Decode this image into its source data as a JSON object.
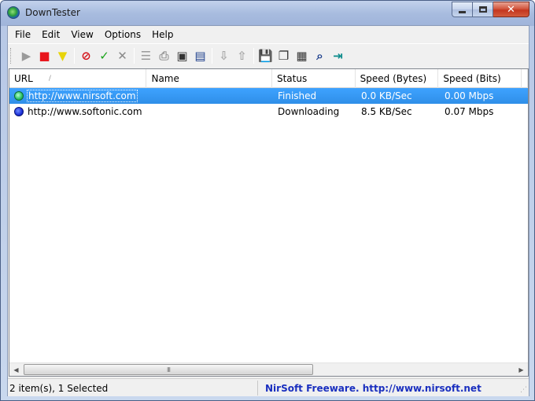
{
  "window": {
    "title": "DownTester"
  },
  "menu": [
    "File",
    "Edit",
    "View",
    "Options",
    "Help"
  ],
  "toolbar": {
    "buttons": [
      {
        "name": "start-icon",
        "glyph": "▶",
        "color": "#9a9a9a"
      },
      {
        "name": "stop-icon",
        "glyph": "■",
        "color": "#e8141b"
      },
      {
        "name": "funnel-icon",
        "glyph": "▼",
        "color": "#e8d40a"
      },
      {
        "name": "block-icon",
        "glyph": "⊘",
        "color": "#d4141b"
      },
      {
        "name": "checkmark-icon",
        "glyph": "✓",
        "color": "#1aa31a"
      },
      {
        "name": "delete-x-icon",
        "glyph": "✕",
        "color": "#8a8a8a"
      },
      {
        "name": "list-icon",
        "glyph": "☰",
        "color": "#9a9a9a"
      },
      {
        "name": "print-icon",
        "glyph": "⎙",
        "color": "#9a9a9a"
      },
      {
        "name": "new-item-icon",
        "glyph": "▣",
        "color": "#333333"
      },
      {
        "name": "window-icon",
        "glyph": "▤",
        "color": "#1c3e8c"
      },
      {
        "name": "move-down-icon",
        "glyph": "⇩",
        "color": "#a8a8a8"
      },
      {
        "name": "move-up-icon",
        "glyph": "⇧",
        "color": "#a8a8a8"
      },
      {
        "name": "save-icon",
        "glyph": "💾",
        "color": "#1c3e8c"
      },
      {
        "name": "copy-icon",
        "glyph": "❐",
        "color": "#333333"
      },
      {
        "name": "properties-icon",
        "glyph": "▦",
        "color": "#333333"
      },
      {
        "name": "find-icon",
        "glyph": "⌕",
        "color": "#1c3e8c"
      },
      {
        "name": "exit-icon",
        "glyph": "⇥",
        "color": "#0a8a8a"
      }
    ]
  },
  "table": {
    "columns": [
      "URL",
      "Name",
      "Status",
      "Speed (Bytes)",
      "Speed (Bits)"
    ],
    "sort_indicator": "/",
    "rows": [
      {
        "url": "http://www.nirsoft.com",
        "name": "",
        "status": "Finished",
        "speed_bytes": "0.0 KB/Sec",
        "speed_bits": "0.00 Mbps",
        "state": "finished",
        "selected": true
      },
      {
        "url": "http://www.softonic.com",
        "name": "",
        "status": "Downloading",
        "speed_bytes": "8.5 KB/Sec",
        "speed_bits": "0.07 Mbps",
        "state": "downloading",
        "selected": false
      }
    ]
  },
  "scrollbar": {
    "grip": "III",
    "left_arrow": "◀",
    "right_arrow": "▶"
  },
  "status": {
    "items": "2 item(s), 1 Selected",
    "link": "NirSoft Freeware.  http://www.nirsoft.net"
  },
  "colors": {
    "selection": "#3399ff",
    "link": "#1a2fbf"
  }
}
